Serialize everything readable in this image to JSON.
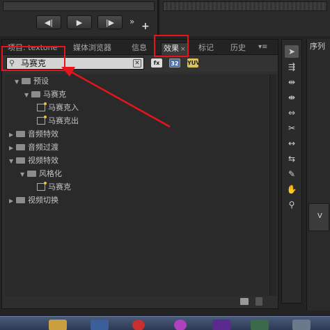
{
  "transport": {
    "step_back_label": "◀|",
    "play_label": "▶",
    "step_fwd_label": "|▶",
    "more_label": "»",
    "add_label": "+"
  },
  "tabs": [
    {
      "label": "项目: textone",
      "active": false
    },
    {
      "label": "媒体浏览器",
      "active": false
    },
    {
      "label": "信息",
      "active": false
    },
    {
      "label": "效果",
      "active": true,
      "close": "×"
    },
    {
      "label": "标记",
      "active": false
    },
    {
      "label": "历史",
      "active": false
    }
  ],
  "tab_menu": "▾≡",
  "search": {
    "value": "马赛克",
    "icon": "search-icon",
    "clear": "✕"
  },
  "filter_badges": [
    "fx",
    "32",
    "YUV"
  ],
  "tree": [
    {
      "label": "预设",
      "level": 1,
      "kind": "folder",
      "expanded": true
    },
    {
      "label": "马赛克",
      "level": 2,
      "kind": "folder",
      "expanded": true
    },
    {
      "label": "马赛克入",
      "level": 3,
      "kind": "effect"
    },
    {
      "label": "马赛克出",
      "level": 3,
      "kind": "effect"
    },
    {
      "label": "音频特效",
      "level": 1,
      "kind": "folder",
      "expanded": false
    },
    {
      "label": "音频过渡",
      "level": 1,
      "kind": "folder",
      "expanded": false
    },
    {
      "label": "视频特效",
      "level": 1,
      "kind": "folder",
      "expanded": true
    },
    {
      "label": "风格化",
      "level": 2,
      "kind": "folder",
      "expanded": true
    },
    {
      "label": "马赛克",
      "level": 3,
      "kind": "effect"
    },
    {
      "label": "视频切换",
      "level": 1,
      "kind": "folder",
      "expanded": false
    }
  ],
  "tools": [
    "selection-tool",
    "track-select-tool",
    "ripple-edit-tool",
    "rolling-edit-tool",
    "rate-stretch-tool",
    "razor-tool",
    "slip-tool",
    "slide-tool",
    "pen-tool",
    "hand-tool",
    "zoom-tool"
  ],
  "sequence_tab": "序列",
  "video_track": "V",
  "colors": {
    "highlight": "#e8141c",
    "panel": "#2e2e2e"
  }
}
